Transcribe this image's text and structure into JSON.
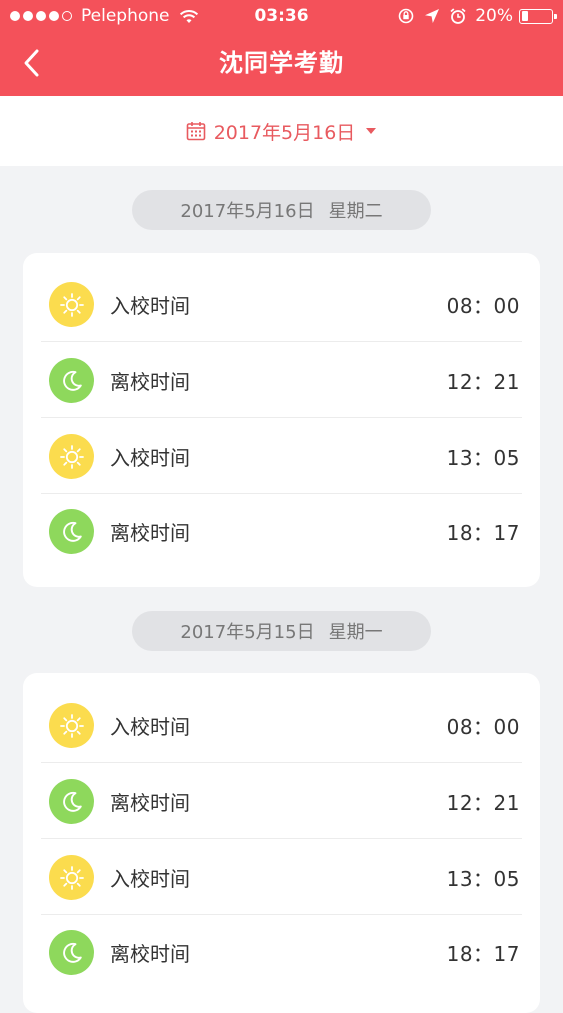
{
  "status_bar": {
    "carrier": "Pelephone",
    "time": "03:36",
    "battery_percent": "20%",
    "battery_level": 0.2
  },
  "nav": {
    "title": "沈同学考勤",
    "back_icon": "chevron-left-icon"
  },
  "date_selector": {
    "icon": "calendar-icon",
    "label": "2017年5月16日",
    "caret": "caret-down-icon"
  },
  "days": [
    {
      "date": "2017年5月16日",
      "weekday": "星期二",
      "entries": [
        {
          "type": "in",
          "icon": "sun-icon",
          "label": "入校时间",
          "time": "08：00"
        },
        {
          "type": "out",
          "icon": "moon-icon",
          "label": "离校时间",
          "time": "12：21"
        },
        {
          "type": "in",
          "icon": "sun-icon",
          "label": "入校时间",
          "time": "13：05"
        },
        {
          "type": "out",
          "icon": "moon-icon",
          "label": "离校时间",
          "time": "18：17"
        }
      ]
    },
    {
      "date": "2017年5月15日",
      "weekday": "星期一",
      "entries": [
        {
          "type": "in",
          "icon": "sun-icon",
          "label": "入校时间",
          "time": "08：00"
        },
        {
          "type": "out",
          "icon": "moon-icon",
          "label": "离校时间",
          "time": "12：21"
        },
        {
          "type": "in",
          "icon": "sun-icon",
          "label": "入校时间",
          "time": "13：05"
        },
        {
          "type": "out",
          "icon": "moon-icon",
          "label": "离校时间",
          "time": "18：17"
        }
      ]
    }
  ],
  "colors": {
    "header": "#f4515a",
    "accent_text": "#e85a5f",
    "sun": "#fbdc4e",
    "moon": "#8ed85c",
    "background": "#f2f3f5"
  }
}
